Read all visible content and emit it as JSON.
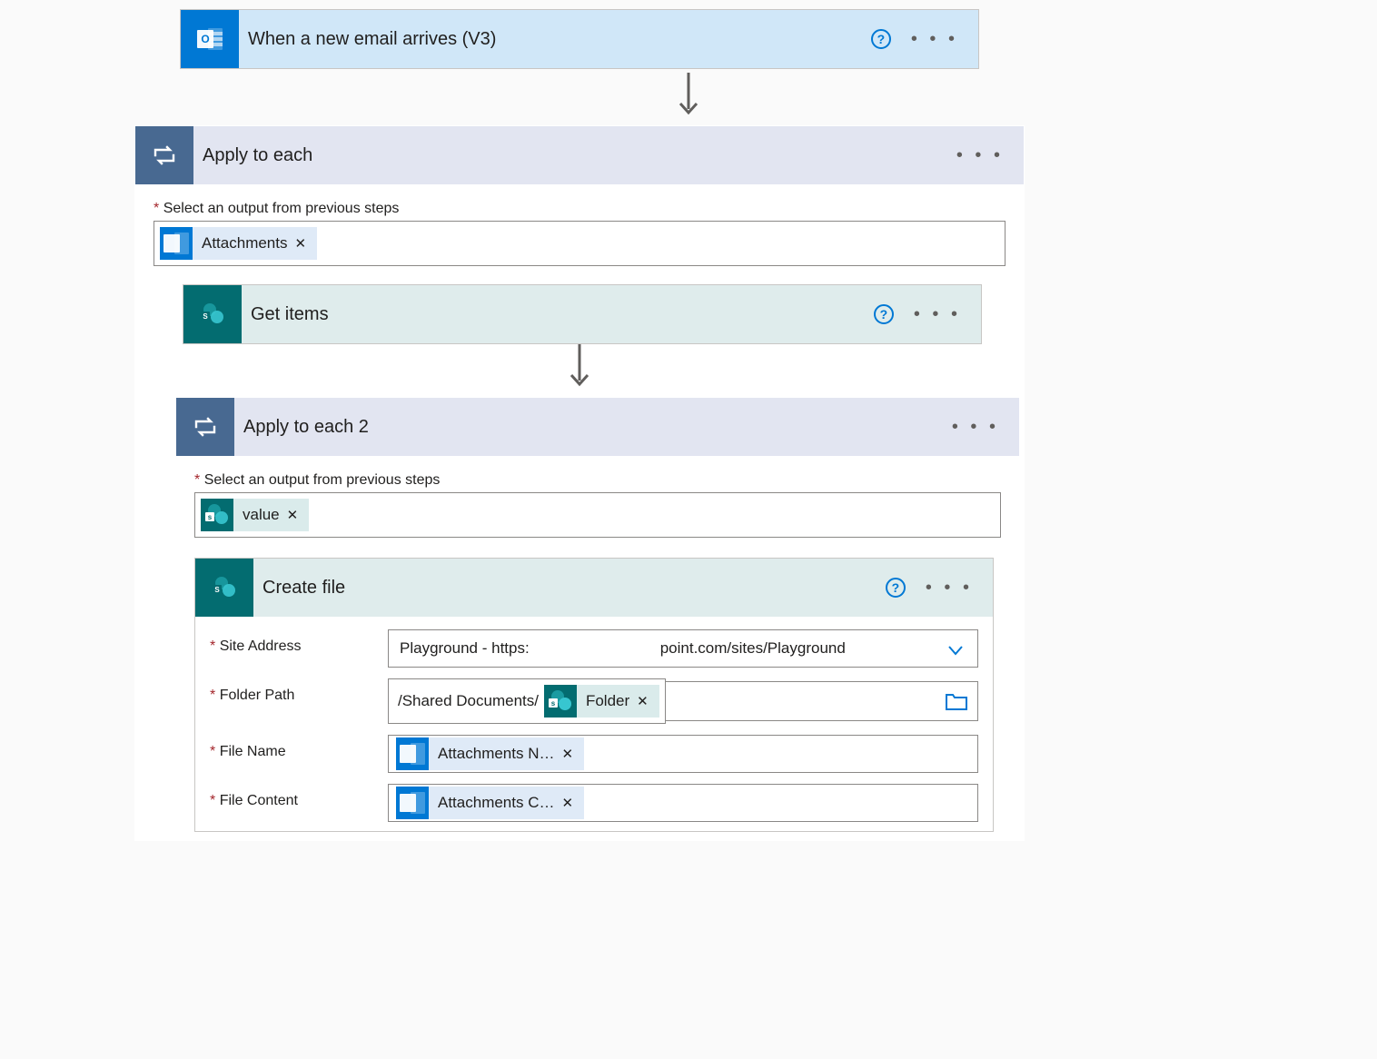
{
  "trigger": {
    "title": "When a new email arrives (V3)"
  },
  "apply1": {
    "title": "Apply to each",
    "select_label": "Select an output from previous steps",
    "token": "Attachments"
  },
  "getitems": {
    "title": "Get items"
  },
  "apply2": {
    "title": "Apply to each 2",
    "select_label": "Select an output from previous steps",
    "token": "value"
  },
  "createfile": {
    "title": "Create file",
    "site_label": "Site Address",
    "site_value_left": "Playground - https:",
    "site_value_right": "point.com/sites/Playground",
    "folder_label": "Folder Path",
    "folder_prefix": "/Shared Documents/",
    "folder_token": "Folder",
    "name_label": "File Name",
    "name_token": "Attachments N…",
    "content_label": "File Content",
    "content_token": "Attachments C…"
  },
  "glyphs": {
    "ellipsis": "• • •",
    "x": "✕",
    "q": "?"
  }
}
